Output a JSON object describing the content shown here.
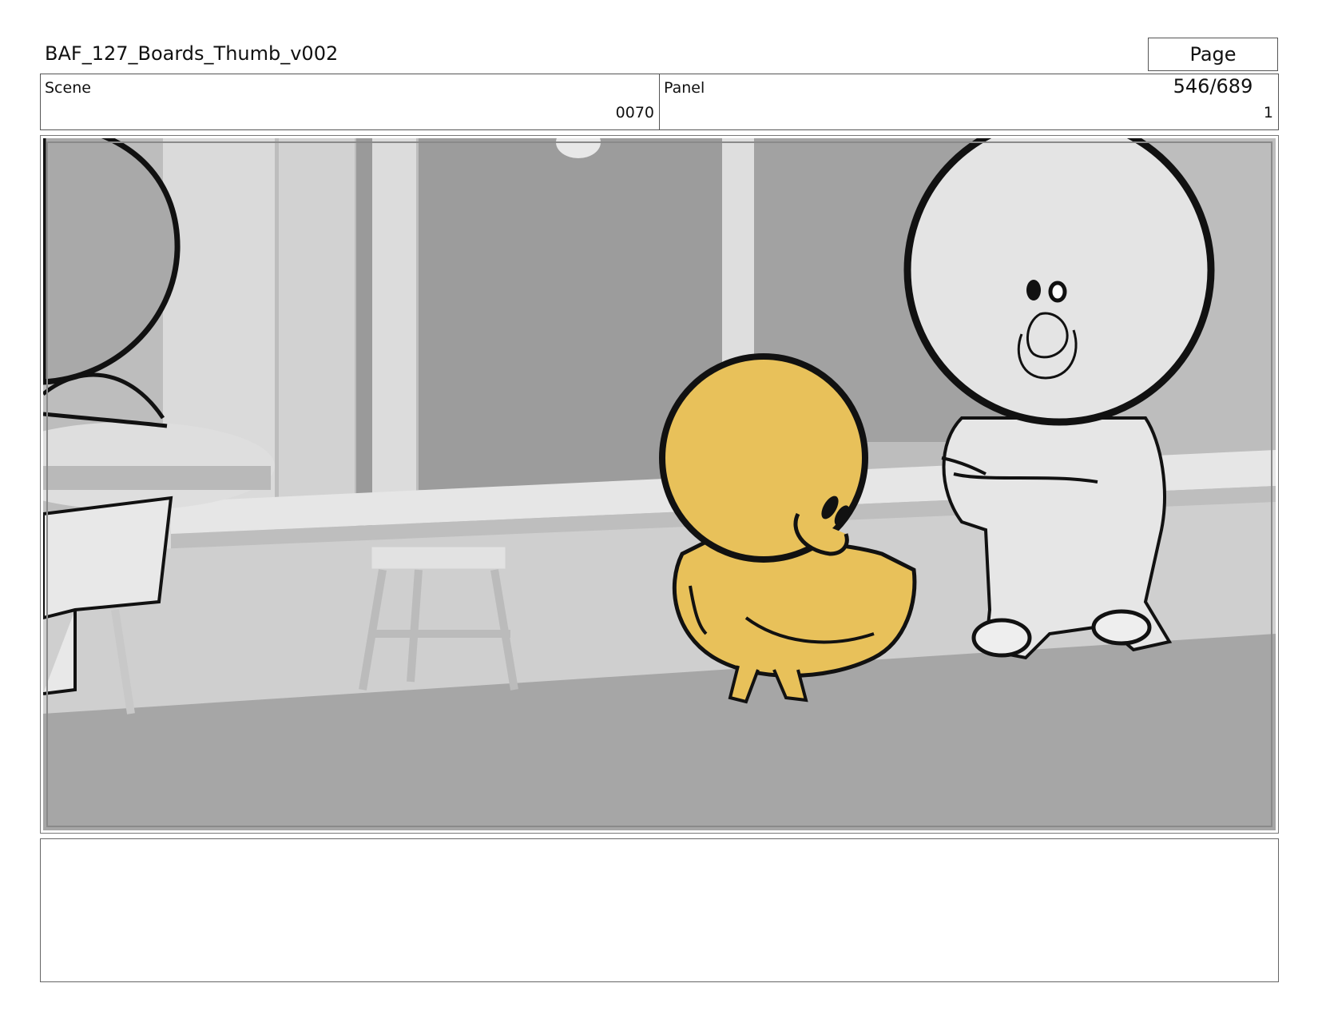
{
  "header": {
    "title": "BAF_127_Boards_Thumb_v002",
    "page": "Page 546/689"
  },
  "info": {
    "scene_label": "Scene",
    "scene_value": "0070",
    "panel_label": "Panel",
    "panel_value": "1"
  },
  "panel": {
    "description": "Storyboard sketch: yellow chick seen from behind in a grey cafe interior with stools, a large white round-headed bear character standing on the right, partial character at left edge",
    "colors": {
      "chick": "#e8c15a",
      "bear": "#e4e4e4",
      "background": "#a3a3a3"
    }
  },
  "notes": {
    "text": ""
  }
}
